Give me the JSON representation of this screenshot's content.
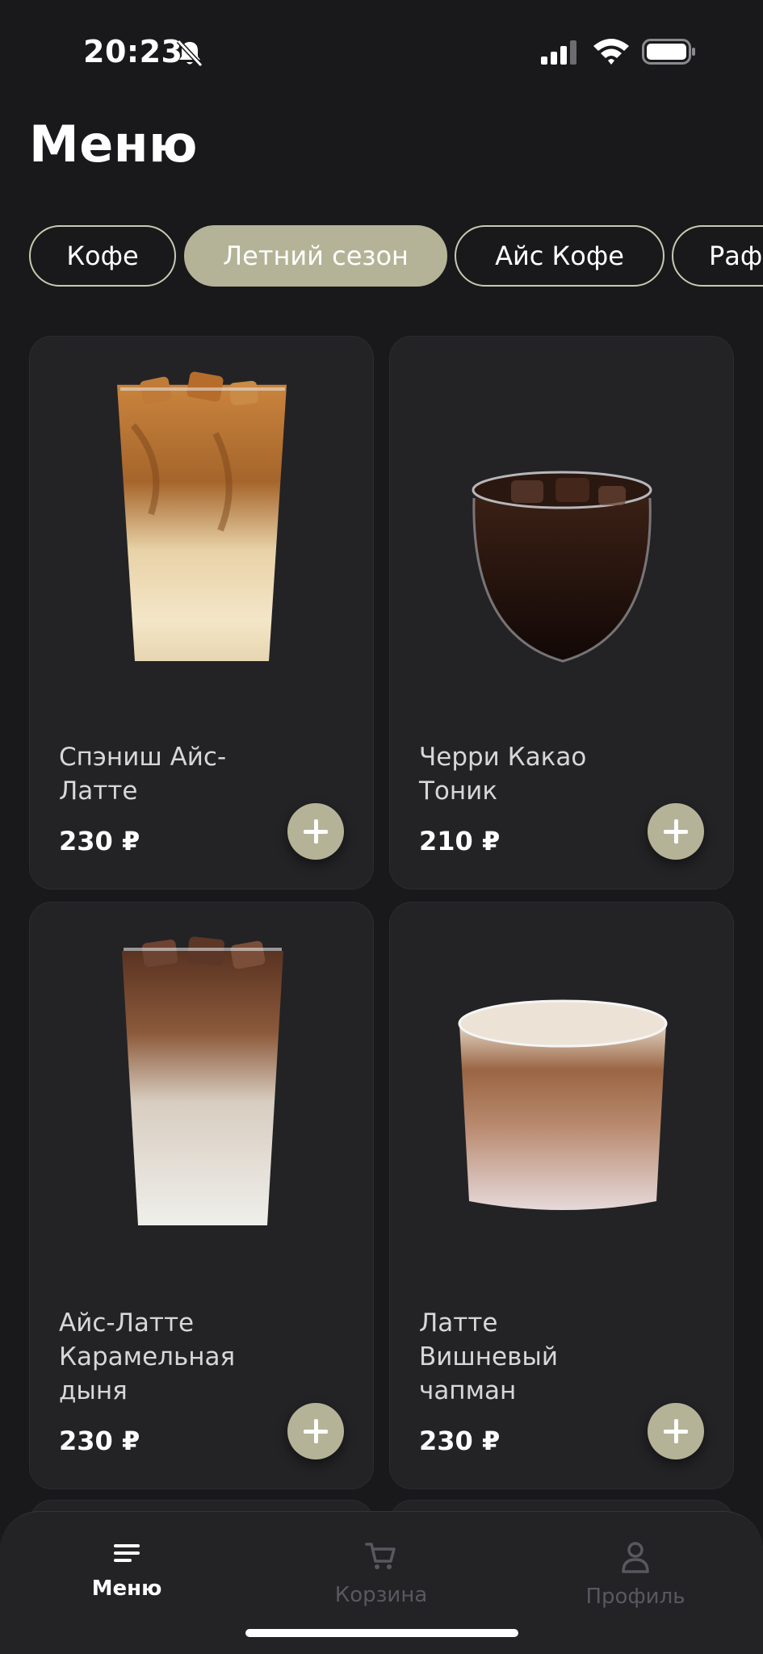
{
  "status_bar": {
    "time": "20:23",
    "icons": [
      "bell-off-icon",
      "signal-icon",
      "wifi-icon",
      "battery-icon"
    ]
  },
  "page": {
    "title": "Меню"
  },
  "categories": [
    {
      "label": "Кофе",
      "active": false
    },
    {
      "label": "Летний сезон",
      "active": true
    },
    {
      "label": "Айс Кофе",
      "active": false
    },
    {
      "label": "Раф",
      "active": false
    }
  ],
  "products": [
    {
      "name_line1": "Спэниш Айс-",
      "name_line2": "Латте",
      "name_line3": "",
      "price": "230 ₽"
    },
    {
      "name_line1": "Черри Какао",
      "name_line2": "Тоник",
      "name_line3": "",
      "price": "210 ₽"
    },
    {
      "name_line1": "Айс-Латте",
      "name_line2": "Карамельная",
      "name_line3": "дыня",
      "price": "230 ₽"
    },
    {
      "name_line1": "Латте",
      "name_line2": "Вишневый",
      "name_line3": "чапман",
      "price": "230 ₽"
    }
  ],
  "nav": [
    {
      "label": "Меню",
      "icon": "menu-icon",
      "active": true
    },
    {
      "label": "Корзина",
      "icon": "cart-icon",
      "active": false
    },
    {
      "label": "Профиль",
      "icon": "profile-icon",
      "active": false
    }
  ],
  "colors": {
    "background": "#19191b",
    "card": "#232326",
    "accent": "#b5b397",
    "inactive": "#58585e"
  }
}
